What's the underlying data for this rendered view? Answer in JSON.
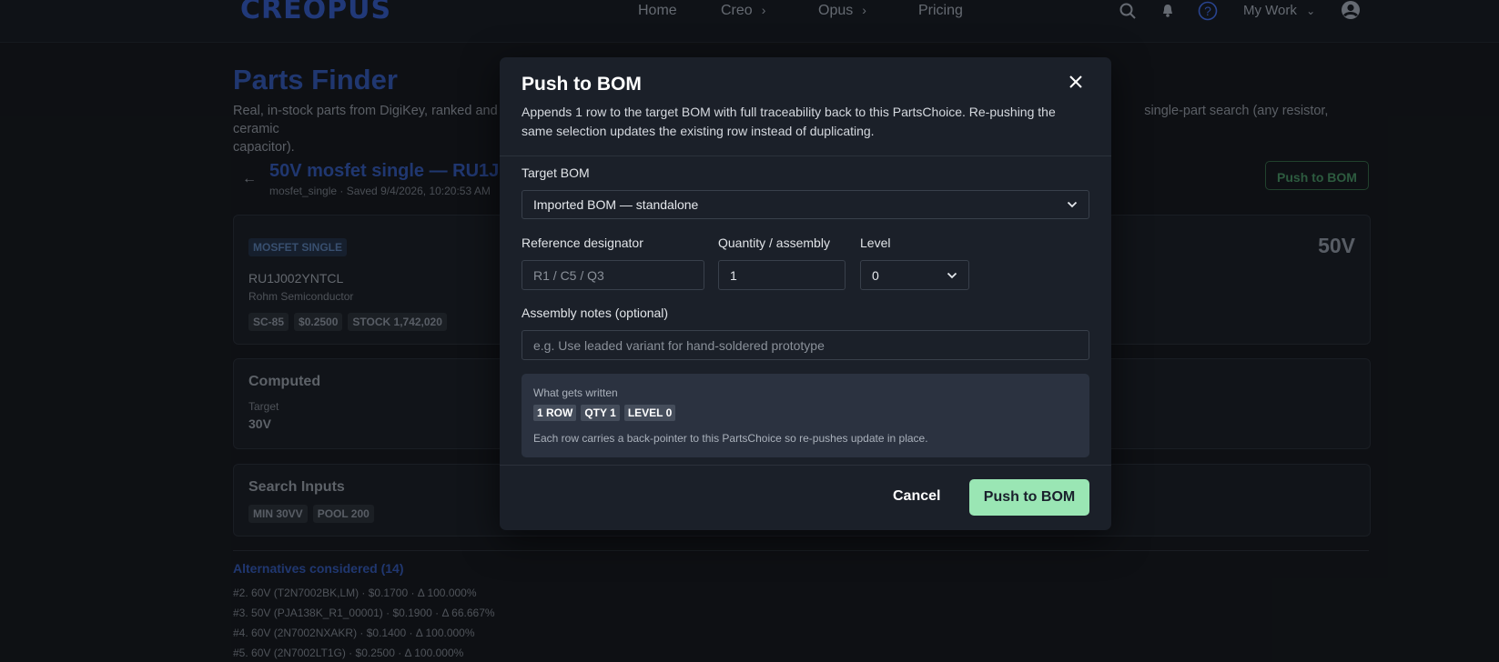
{
  "nav": {
    "logo": "CREOPUS",
    "links": [
      "Home",
      "Creo",
      "Opus",
      "Pricing"
    ],
    "chevron": "›",
    "my_work": "My Work",
    "my_work_chevron": "⌄",
    "icons": [
      "search-icon",
      "bell-icon",
      "help-icon",
      "user-avatar-icon"
    ]
  },
  "page": {
    "title": "Parts Finder",
    "description": "Real, in-stock parts from DigiKey, ranked and sc",
    "description_tail": "single-part search (any resistor, ceramic",
    "description_line2": "capacitor).",
    "back": "←",
    "choice_title": "50V mosfet single — RU1J",
    "choice_meta": "mosfet_single  ·  Saved 9/4/2026, 10:20:53 AM",
    "push_button": "Push to BOM"
  },
  "part_card": {
    "category": "MOSFET SINGLE",
    "part_number": "RU1J002YNTCL",
    "manufacturer": "Rohm Semiconductor",
    "chips": [
      "SC-85",
      "$0.2500",
      "STOCK 1,742,020"
    ],
    "headline_value": "50V"
  },
  "computed_card": {
    "title": "Computed",
    "target_label": "Target",
    "target_value": "30V"
  },
  "search_card": {
    "title": "Search Inputs",
    "chips": [
      "MIN 30VV",
      "POOL 200"
    ]
  },
  "alternatives": {
    "heading": "Alternatives considered (14)",
    "rows": [
      "#2.  60V  (T2N7002BK,LM)  ·  $0.1700  ·  Δ 100.000%",
      "#3.  50V  (PJA138K_R1_00001)  ·  $0.1900  ·  Δ 66.667%",
      "#4.  60V  (2N7002NXAKR)  ·  $0.1400  ·  Δ 100.000%",
      "#5.  60V  (2N7002LT1G)  ·  $0.2500  ·  Δ 100.000%"
    ]
  },
  "modal": {
    "title": "Push to BOM",
    "description": "Appends 1 row to the target BOM with full traceability back to this PartsChoice. Re-pushing the same selection updates the existing row instead of duplicating.",
    "target_bom_label": "Target BOM",
    "target_bom_value": "Imported BOM — standalone",
    "refdes_label": "Reference designator",
    "refdes_placeholder": "R1 / C5 / Q3",
    "refdes_value": "",
    "qty_label": "Quantity / assembly",
    "qty_value": "1",
    "level_label": "Level",
    "level_value": "0",
    "notes_label": "Assembly notes (optional)",
    "notes_placeholder": "e.g. Use leaded variant for hand-soldered prototype",
    "notes_value": "",
    "written_label": "What gets written",
    "written_chips": [
      "1 ROW",
      "QTY 1",
      "LEVEL 0"
    ],
    "written_note": "Each row carries a back-pointer to this PartsChoice so re-pushes update in place.",
    "cancel_label": "Cancel",
    "submit_label": "Push to BOM"
  },
  "colors": {
    "primary_button": "#9ae6b4",
    "brand_blue": "#2d4d9c",
    "modal_bg": "#1b2029"
  }
}
